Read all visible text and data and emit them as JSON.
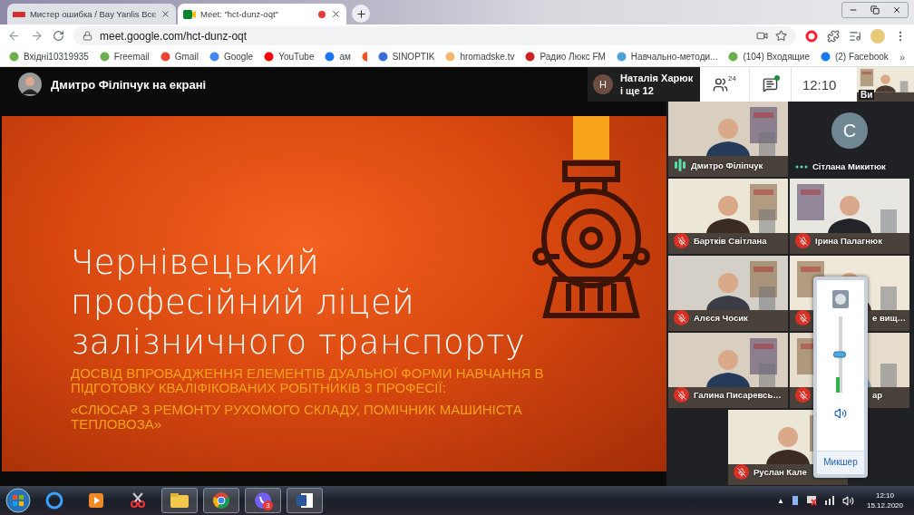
{
  "tabs": [
    {
      "title": "Мистер ошибка / Bay Yanlis Всє",
      "selected": false,
      "recording": false
    },
    {
      "title": "Meet: \"hct-dunz-oqt\"",
      "selected": true,
      "recording": true
    }
  ],
  "address": {
    "url": "meet.google.com/hct-dunz-oqt"
  },
  "bookmarks": [
    {
      "kind": "link",
      "label": "Вхідні10319935"
    },
    {
      "kind": "link",
      "label": "Freemail"
    },
    {
      "kind": "link",
      "label": "Gmail"
    },
    {
      "kind": "link",
      "label": "Google"
    },
    {
      "kind": "link",
      "label": "YouTube"
    },
    {
      "kind": "link",
      "label": "ам"
    },
    {
      "kind": "icon"
    },
    {
      "kind": "link",
      "label": "SINOPTIK"
    },
    {
      "kind": "link",
      "label": "hromadske.tv"
    },
    {
      "kind": "link",
      "label": "Радио Люкс FM"
    },
    {
      "kind": "link",
      "label": "Навчально-методи..."
    },
    {
      "kind": "link",
      "label": "(104) Входящие"
    },
    {
      "kind": "link",
      "label": "(2) Facebook"
    }
  ],
  "bookmarks_more": "»",
  "meeting": {
    "presenter": "Дмитро Філіпчук на екрані",
    "speaker_initial": "Н",
    "speaker_name": "Наталія Харюк",
    "speaker_more": "і ще 12",
    "people_count": "24",
    "chat_unread": true,
    "time": "12:10",
    "self_label": "Ви"
  },
  "slide": {
    "title_lines": [
      "Чернівецький",
      "професійний ліцей",
      "залізничного транспорту"
    ],
    "subtitle": "ДОСВІД ВПРОВАДЖЕННЯ ЕЛЕМЕНТІВ ДУАЛЬНОЇ ФОРМИ НАВЧАННЯ В ПІДГОТОВКУ КВАЛІФІКОВАНИХ РОБІТНИКІВ З ПРОФЕСІЇ:",
    "quote": "«СЛЮСАР З РЕМОНТУ РУХОМОГО СКЛАДУ, ПОМІЧНИК МАШИНІСТА ТЕПЛОВОЗА»"
  },
  "tiles": [
    {
      "kind": "video",
      "name": "Дмитро Філіпчук",
      "muted": false,
      "speaking": true,
      "behind_mixer": false
    },
    {
      "kind": "avatar",
      "initial": "С",
      "name": "Сітлана Микитюк",
      "muted": false,
      "speaking": false,
      "behind_mixer": false
    },
    {
      "kind": "video",
      "name": "Бартків Світлана",
      "muted": true,
      "behind_mixer": false
    },
    {
      "kind": "video",
      "name": "Ірина Палагнюк",
      "muted": true,
      "behind_mixer": false
    },
    {
      "kind": "video",
      "name": "Алєся Чосик",
      "muted": true,
      "behind_mixer": false
    },
    {
      "kind": "video",
      "name": "е вищ…",
      "muted": true,
      "behind_mixer": true
    },
    {
      "kind": "video",
      "name": "Галина Писаревсь…",
      "muted": true,
      "behind_mixer": false
    },
    {
      "kind": "video",
      "name": "ар",
      "muted": true,
      "behind_mixer": true
    },
    {
      "kind": "video",
      "name": "Руслан Кале",
      "muted": true,
      "behind_mixer": false
    }
  ],
  "mixer": {
    "volume": {
      "level": 0.5
    },
    "meter": {
      "level": 0.2
    },
    "link": "Микшер"
  },
  "taskbar": {
    "viber_badge": "3",
    "tray_expand": "▲",
    "time": "12:10",
    "date": "15.12.2020"
  }
}
